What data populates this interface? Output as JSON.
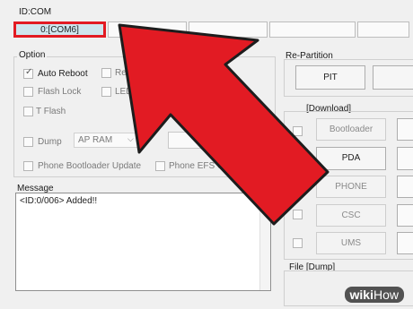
{
  "idcom": {
    "title": "ID:COM",
    "active_port": "0:[COM6]"
  },
  "option": {
    "title": "Option",
    "auto_reboot": "Auto Reboot",
    "re_partition": "Re-Pa",
    "flash_lock": "Flash Lock",
    "led_control": "LED Control",
    "t_flash": "T Flash",
    "dump": "Dump",
    "dump_select": "AP RAM",
    "phone_bootloader_update": "Phone Bootloader Update",
    "phone_efs_clear": "Phone EFS Clear"
  },
  "repartition": {
    "title": "Re-Partition",
    "pit": "PIT"
  },
  "files": {
    "title": "[Download]",
    "bootloader": "Bootloader",
    "pda": "PDA",
    "phone": "PHONE",
    "csc": "CSC",
    "ums": "UMS"
  },
  "message": {
    "title": "Message",
    "text": "<ID:0/006> Added!!"
  },
  "file_dump": {
    "title": "File [Dump]"
  },
  "watermark": {
    "part1": "wiki",
    "part2": "How"
  },
  "colors": {
    "highlight_border": "#e21b23",
    "active_port_bg": "#cfe6ee",
    "arrow_fill": "#e21b23"
  }
}
